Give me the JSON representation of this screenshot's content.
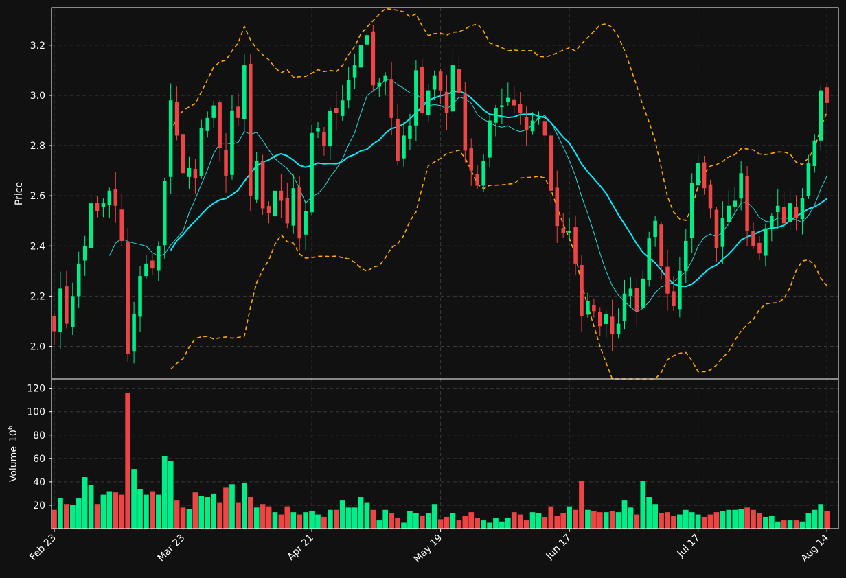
{
  "chart_data": {
    "type": "candlestick",
    "title": "",
    "price_ylabel": "Price",
    "volume_ylabel": "Volume",
    "volume_unit_base": "10",
    "volume_unit_exp": "6",
    "x_tick_labels": [
      "Feb 23",
      "Mar 23",
      "Apr 21",
      "May 19",
      "Jun 17",
      "Jul 17",
      "Aug 14"
    ],
    "x_tick_index": [
      0,
      21,
      42,
      63,
      84,
      105,
      126
    ],
    "price_ylim": [
      1.87,
      3.35
    ],
    "price_yticks": [
      2.0,
      2.2,
      2.4,
      2.6,
      2.8,
      3.0,
      3.2
    ],
    "volume_ylim": [
      0,
      128
    ],
    "volume_yticks": [
      20,
      40,
      60,
      80,
      100,
      120
    ],
    "grid": true,
    "colors": {
      "background": "#111111",
      "up": "#00ee88",
      "down": "#ee4444",
      "ma_fast": "#22dddd",
      "ma_slow": "#00eeff",
      "bands": "#ffaa00",
      "grid": "#3a3a3a",
      "axis": "#ffffff"
    },
    "series": [
      {
        "name": "ohlc",
        "close": [
          2.06,
          2.23,
          2.09,
          2.2,
          2.33,
          2.4,
          2.57,
          2.54,
          2.57,
          2.62,
          2.56,
          2.42,
          1.97,
          2.13,
          2.28,
          2.33,
          2.31,
          2.4,
          2.66,
          2.98,
          2.84,
          2.69,
          2.71,
          2.67,
          2.87,
          2.91,
          2.96,
          2.79,
          2.68,
          2.94,
          2.91,
          3.12,
          2.6,
          2.74,
          2.55,
          2.53,
          2.62,
          2.58,
          2.49,
          2.63,
          2.43,
          2.54,
          2.85,
          2.87,
          2.8,
          2.94,
          2.93,
          2.98,
          3.06,
          3.12,
          3.2,
          3.24,
          3.04,
          3.05,
          3.08,
          2.91,
          2.74,
          2.84,
          2.88,
          3.1,
          2.93,
          3.02,
          3.08,
          3.02,
          2.93,
          3.12,
          3.01,
          2.78,
          2.7,
          2.64,
          2.74,
          2.9,
          2.95,
          2.96,
          2.99,
          2.96,
          2.93,
          2.86,
          2.9,
          2.91,
          2.84,
          2.62,
          2.48,
          2.45,
          2.46,
          2.33,
          2.12,
          2.18,
          2.14,
          2.08,
          2.13,
          2.05,
          2.09,
          2.21,
          2.23,
          2.14,
          2.27,
          2.43,
          2.5,
          2.32,
          2.21,
          2.16,
          2.3,
          2.42,
          2.65,
          2.73,
          2.63,
          2.55,
          2.39,
          2.51,
          2.56,
          2.58,
          2.69,
          2.46,
          2.4,
          2.37,
          2.47,
          2.52,
          2.56,
          2.49,
          2.57,
          2.51,
          2.59,
          2.73,
          2.82,
          3.02,
          2.97
        ]
      },
      {
        "name": "volume",
        "values": [
          16,
          26,
          21,
          20,
          26,
          44,
          37,
          21,
          29,
          32,
          31,
          29,
          116,
          51,
          34,
          29,
          32,
          29,
          62,
          58,
          24,
          18,
          17,
          31,
          28,
          27,
          30,
          22,
          35,
          38,
          22,
          39,
          27,
          18,
          21,
          19,
          14,
          12,
          19,
          14,
          12,
          14,
          15,
          12,
          10,
          16,
          16,
          24,
          18,
          18,
          27,
          22,
          16,
          7,
          16,
          13,
          9,
          5,
          15,
          13,
          11,
          13,
          21,
          8,
          10,
          13,
          7,
          11,
          14,
          9,
          7,
          5,
          9,
          6,
          9,
          14,
          12,
          7,
          14,
          13,
          10,
          19,
          11,
          13,
          19,
          16,
          41,
          16,
          15,
          14,
          14,
          15,
          14,
          24,
          18,
          12,
          41,
          27,
          21,
          13,
          14,
          11,
          12,
          16,
          14,
          12,
          10,
          12,
          14,
          15,
          16,
          16,
          17,
          18,
          16,
          13,
          10,
          11,
          6,
          7,
          7,
          7,
          6,
          13,
          16,
          21,
          15
        ]
      }
    ]
  }
}
